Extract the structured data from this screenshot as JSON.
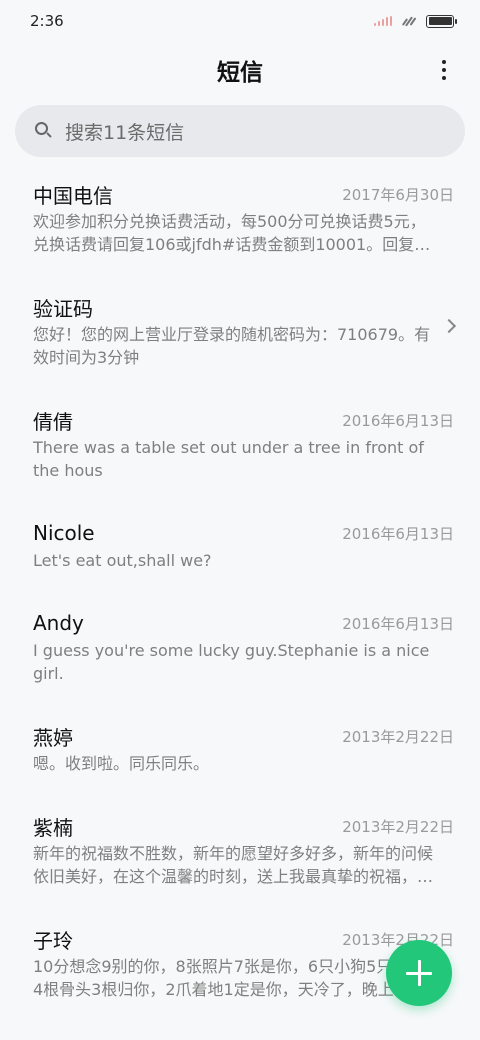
{
  "status_bar": {
    "time": "2:36"
  },
  "header": {
    "title": "短信"
  },
  "search": {
    "placeholder": "搜索11条短信"
  },
  "messages": [
    {
      "sender": "中国电信",
      "date": "2017年6月30日",
      "preview": "欢迎参加积分兑换话费活动，每500分可兑换话费5元，兑换话费请回复106或jfdh#话费金额到10001。回复…"
    },
    {
      "sender": "验证码",
      "date": "",
      "preview": "您好！您的网上营业厅登录的随机密码为：710679。有效时间为3分钟"
    },
    {
      "sender": "倩倩",
      "date": "2016年6月13日",
      "preview": "There was a table set out under a tree in front of the hous"
    },
    {
      "sender": "Nicole",
      "date": "2016年6月13日",
      "preview": "Let's eat out,shall we?"
    },
    {
      "sender": "Andy",
      "date": "2016年6月13日",
      "preview": "I guess you're some lucky guy.Stephanie is a nice girl."
    },
    {
      "sender": "燕婷",
      "date": "2013年2月22日",
      "preview": "嗯。收到啦。同乐同乐。"
    },
    {
      "sender": "紫楠",
      "date": "2013年2月22日",
      "preview": "新年的祝福数不胜数，新年的愿望好多好多，新年的问候依旧美好，在这个温馨的时刻，送上我最真挚的祝福，…"
    },
    {
      "sender": "子玲",
      "date": "2013年2月22日",
      "preview": "10分想念9别的你，8张照片7张是你，6只小狗5只像你，4根骨头3根归你，2爪着地1定是你，天冷了，晚上记得…"
    }
  ],
  "colors": {
    "accent": "#22c77a",
    "background": "#f7f8fa"
  },
  "icons": {
    "more": "more-vert-icon",
    "search": "search-icon",
    "compose": "plus-icon",
    "chevron": "chevron-right-icon"
  }
}
